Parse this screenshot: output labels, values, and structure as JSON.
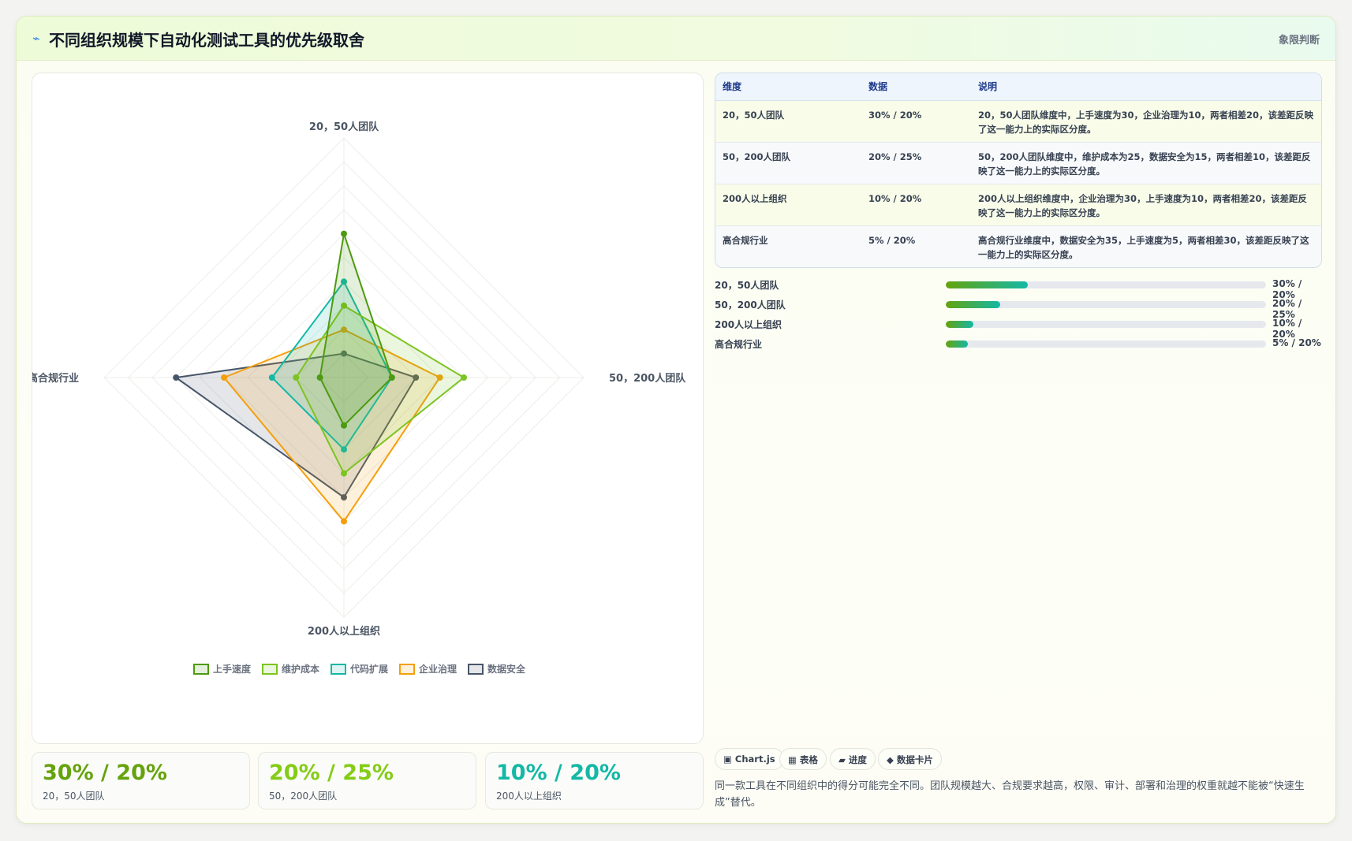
{
  "header": {
    "icon": "spark-icon",
    "title": "不同组织规模下自动化测试工具的优先级取舍",
    "tag": "象限判断"
  },
  "chart_data": {
    "type": "radar",
    "axes": [
      "20，50人团队",
      "50，200人团队",
      "200人以上组织",
      "高合规行业"
    ],
    "range": [
      0,
      50
    ],
    "series": [
      {
        "name": "上手速度",
        "values": [
          30,
          10,
          10,
          5
        ],
        "color": "#4d9a10"
      },
      {
        "name": "维护成本",
        "values": [
          15,
          25,
          20,
          10
        ],
        "color": "#7cc420"
      },
      {
        "name": "代码扩展",
        "values": [
          20,
          10,
          15,
          15
        ],
        "color": "#14b8a6"
      },
      {
        "name": "企业治理",
        "values": [
          10,
          20,
          30,
          25
        ],
        "color": "#f59e0b"
      },
      {
        "name": "数据安全",
        "values": [
          5,
          15,
          25,
          35
        ],
        "color": "#475569"
      }
    ],
    "legend_position": "bottom"
  },
  "stats": [
    {
      "value": "30% / 20%",
      "label": "20，50人团队",
      "color": "#65a30d"
    },
    {
      "value": "20% / 25%",
      "label": "50，200人团队",
      "color": "#84cc16"
    },
    {
      "value": "10% / 20%",
      "label": "200人以上组织",
      "color": "#14b8a6"
    }
  ],
  "table": {
    "headers": [
      "维度",
      "数据",
      "说明"
    ],
    "rows": [
      [
        "20，50人团队",
        "30% / 20%",
        "20，50人团队维度中，上手速度为30，企业治理为10，两者相差20，该差距反映了这一能力上的实际区分度。"
      ],
      [
        "50，200人团队",
        "20% / 25%",
        "50，200人团队维度中，维护成本为25，数据安全为15，两者相差10，该差距反映了这一能力上的实际区分度。"
      ],
      [
        "200人以上组织",
        "10% / 20%",
        "200人以上组织维度中，企业治理为30，上手速度为10，两者相差20，该差距反映了这一能力上的实际区分度。"
      ],
      [
        "高合规行业",
        "5% / 20%",
        "高合规行业维度中，数据安全为35，上手速度为5，两者相差30，该差距反映了这一能力上的实际区分度。"
      ]
    ]
  },
  "progress": [
    {
      "label": "20，50人团队",
      "value": "30% / 20%",
      "fraction": 0.255
    },
    {
      "label": "50，200人团队",
      "value": "20% / 25%",
      "fraction": 0.17
    },
    {
      "label": "200人以上组织",
      "value": "10% / 20%",
      "fraction": 0.085
    },
    {
      "label": "高合规行业",
      "value": "5% / 20%",
      "fraction": 0.068
    }
  ],
  "chips": [
    {
      "icon": "▣",
      "label": "Chart.js"
    },
    {
      "icon": "▦",
      "label": "表格"
    },
    {
      "icon": "▰",
      "label": "进度"
    },
    {
      "icon": "◆",
      "label": "数据卡片"
    }
  ],
  "footnote": "同一款工具在不同组织中的得分可能完全不同。团队规模越大、合规要求越高，权限、审计、部署和治理的权重就越不能被“快速生成”替代。"
}
